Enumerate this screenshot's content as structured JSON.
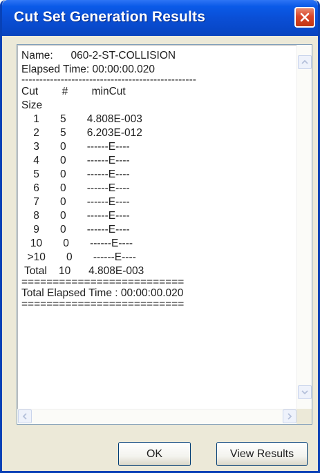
{
  "window": {
    "title": "Cut Set Generation Results"
  },
  "results": {
    "name_line": "Name:      060-2-ST-COLLISION",
    "elapsed_line": "Elapsed Time: 00:00:00.020",
    "separator1": "-------------------------------------------------",
    "header_line1": "Cut        #        minCut",
    "header_line2": "Size",
    "rows": [
      "    1       5       4.808E-003",
      "    2       5       6.203E-012",
      "    3       0       ------E----",
      "    4       0       ------E----",
      "    5       0       ------E----",
      "    6       0       ------E----",
      "    7       0       ------E----",
      "    8       0       ------E----",
      "    9       0       ------E----",
      "   10       0       ------E----",
      "  >10       0       ------E----"
    ],
    "total_line": " Total    10      4.808E-003",
    "separator2": "==========================",
    "total_elapsed_line": "Total Elapsed Time : 00:00:00.020",
    "separator3": "=========================="
  },
  "buttons": {
    "ok_label": "OK",
    "view_results_label": "View Results"
  },
  "icons": {
    "close": "close-icon",
    "scroll_up": "scroll-up-arrow-icon",
    "scroll_down": "scroll-down-arrow-icon",
    "scroll_left": "scroll-left-arrow-icon",
    "scroll_right": "scroll-right-arrow-icon"
  },
  "colors": {
    "titlebar": "#0a4fd6",
    "close_button": "#d9462a",
    "dialog_background": "#ece9d8"
  }
}
